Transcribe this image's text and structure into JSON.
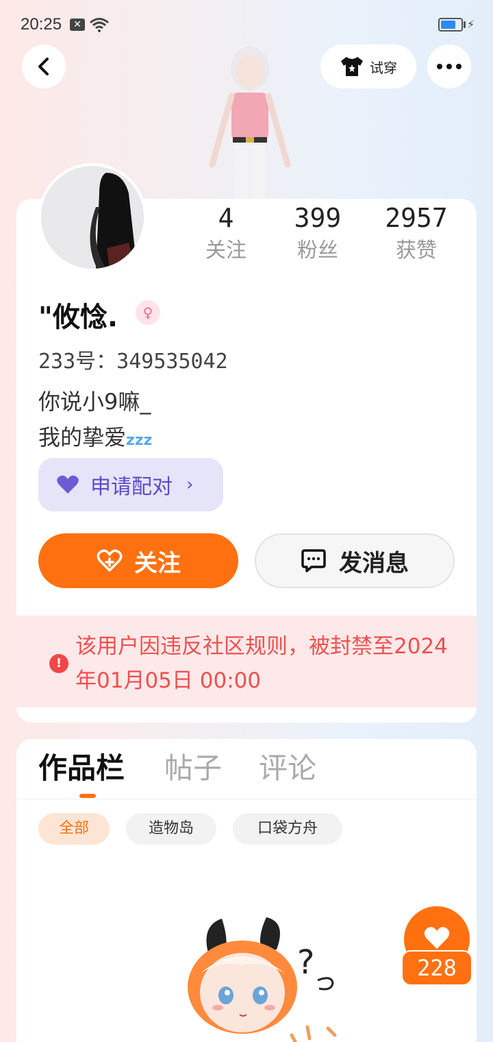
{
  "status_bar": {
    "time": "20:25",
    "notification_icon": "x-icon",
    "wifi_icon": "wifi-icon",
    "battery_level": 0.75,
    "charging": true
  },
  "header": {
    "back_icon": "chevron-left-icon",
    "tryon_label": "试穿",
    "tryon_icon": "tshirt-icon",
    "more_icon": "more-dots-icon"
  },
  "profile": {
    "stats": [
      {
        "value": "4",
        "label": "关注"
      },
      {
        "value": "399",
        "label": "粉丝"
      },
      {
        "value": "2957",
        "label": "获赞"
      }
    ],
    "nickname": "\"攸惗.",
    "gender_symbol": "♀",
    "uid": "233号：349535042",
    "bio_line1": "你说小9嘛_",
    "bio_line2": "我的挚爱",
    "bio_emoji": "zzz",
    "pair_label": "申请配对",
    "follow_label": "关注",
    "message_label": "发消息",
    "ban_notice": "该用户因违反社区规则，被封禁至2024年01月05日 00:00"
  },
  "works": {
    "tabs": [
      {
        "label": "作品栏",
        "active": true
      },
      {
        "label": "帖子",
        "active": false
      },
      {
        "label": "评论",
        "active": false
      }
    ],
    "chips": [
      {
        "label": "全部",
        "active": true
      },
      {
        "label": "造物岛",
        "active": false
      },
      {
        "label": "口袋方舟",
        "active": false
      }
    ]
  },
  "like_fab": {
    "count": "228",
    "icon": "heart-icon"
  },
  "colors": {
    "accent": "#ff7110",
    "pair": "#5a4cc6",
    "warning": "#ef4f4f"
  }
}
